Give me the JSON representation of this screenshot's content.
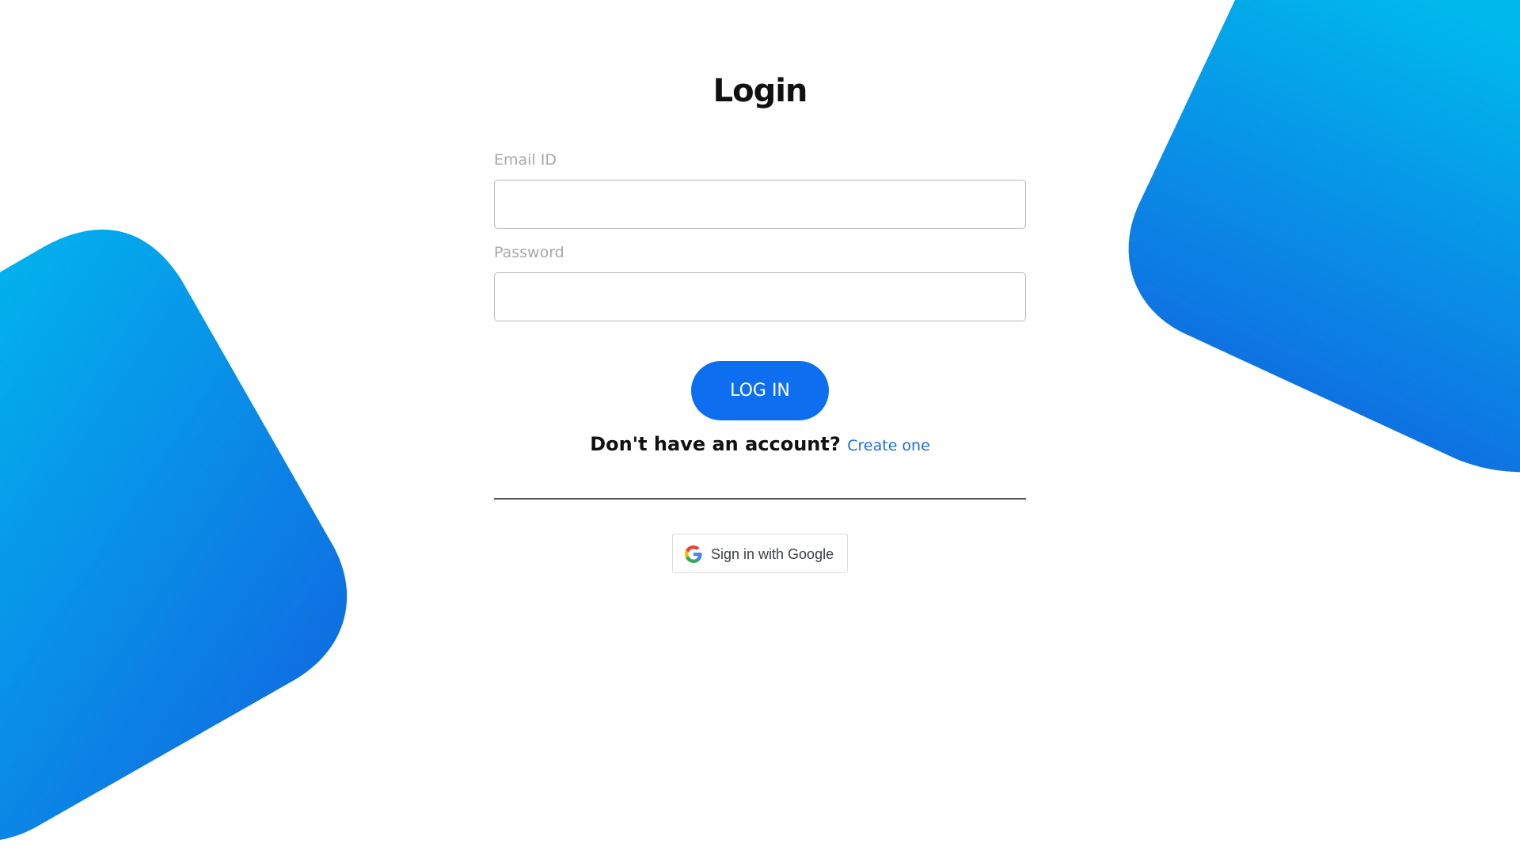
{
  "page": {
    "title": "Login"
  },
  "form": {
    "email_label": "Email ID",
    "email_value": "",
    "password_label": "Password",
    "password_value": "",
    "login_button_label": "LOG IN",
    "signup_question": "Don't have an account?",
    "signup_link_label": "Create one",
    "google_button_label": "Sign in with Google"
  },
  "icons": {
    "google": "google-g-icon"
  },
  "colors": {
    "primary": "#0d6ef0",
    "link": "#1a6fd8",
    "gradient_light": "#00b8ec",
    "gradient_dark": "#1160e0",
    "label_gray": "#a9a9a9",
    "background": "#ffffff"
  }
}
